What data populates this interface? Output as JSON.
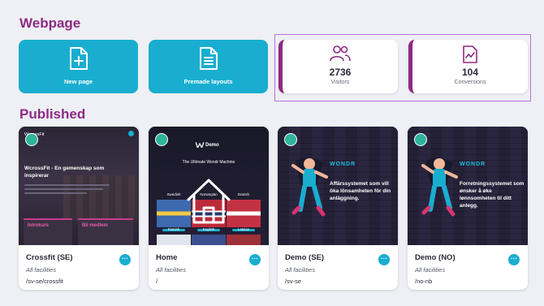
{
  "sections": {
    "webpage_title": "Webpage",
    "published_title": "Published"
  },
  "actions": {
    "new_page": "New page",
    "premade_layouts": "Premade layouts"
  },
  "stats": {
    "visitors": {
      "value": "2736",
      "label": "Visitors"
    },
    "conversions": {
      "value": "104",
      "label": "Conversions"
    }
  },
  "pages": [
    {
      "name": "Crossfit (SE)",
      "facilities": "All facilities",
      "path": "/sv-se/crossfit",
      "thumb": {
        "logo": "WcrossFit",
        "heading": "WcrossFit - En gemenskap som inspirerar",
        "box1": "Introkurs",
        "box2": "Bli medlem"
      }
    },
    {
      "name": "Home",
      "facilities": "All facilities",
      "path": "/",
      "thumb": {
        "logo": "Demo",
        "subtitle": "The Ultimate Wondr Machine",
        "tiles": [
          "Swedish",
          "Norwegian",
          "Danish",
          "Finnish",
          "English",
          "Latvian"
        ]
      }
    },
    {
      "name": "Demo (SE)",
      "facilities": "All facilities",
      "path": "/sv-se",
      "thumb": {
        "logo": "WONDR",
        "text": "Affärssystemet som vill öka lönsamheten för din anläggning."
      }
    },
    {
      "name": "Demo (NO)",
      "facilities": "All facilities",
      "path": "/no-nb",
      "thumb": {
        "logo": "WONDR",
        "text": "Forretningssystemet som ønsker å øke lønnsomheten til ditt anlegg."
      }
    }
  ],
  "more_button": "···",
  "colors": {
    "accent": "#19aed0",
    "brand": "#8e2a83",
    "status": "#2fb39b"
  }
}
